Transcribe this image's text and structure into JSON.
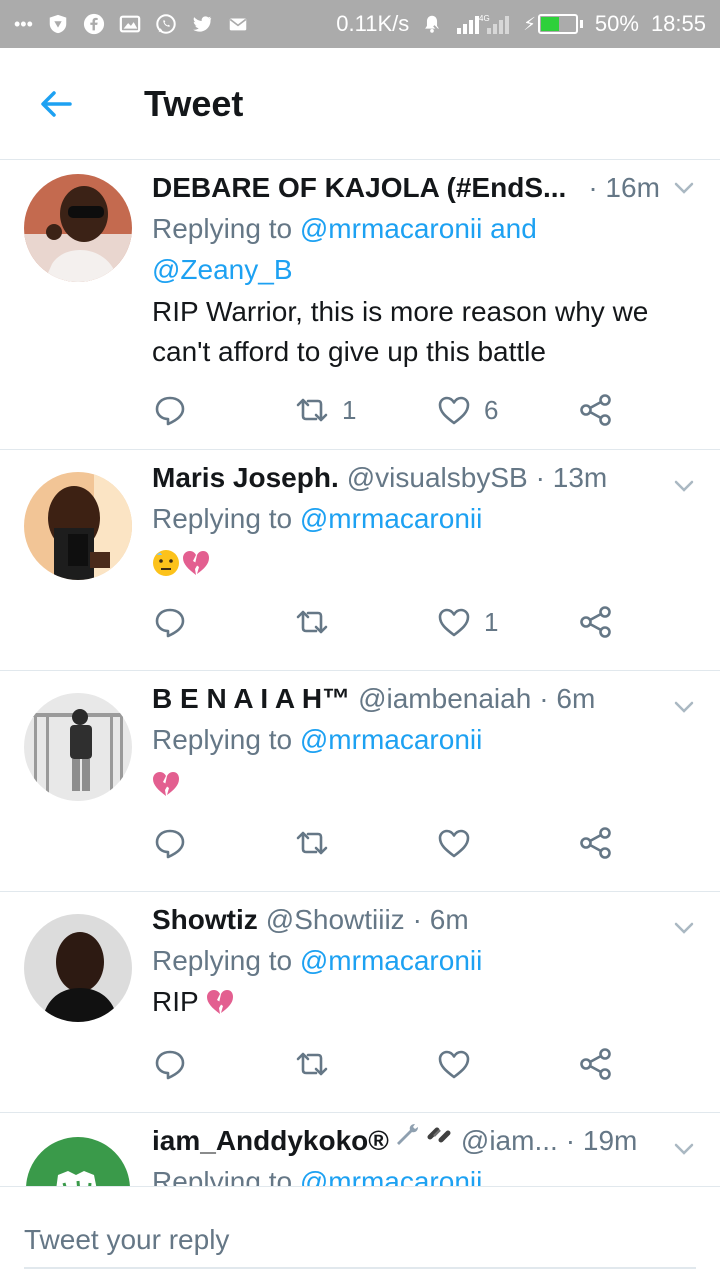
{
  "status_bar": {
    "dots": "•••",
    "speed": "0.11K/s",
    "network": "4G",
    "battery_percent": "50%",
    "battery_level": 0.5,
    "time": "18:55",
    "battery_color": "#2ed03b"
  },
  "header": {
    "title": "Tweet"
  },
  "tweets": [
    {
      "name": "DEBARE OF KAJOLA (#EndS...",
      "handle": "",
      "time": "· 16m",
      "replying_prefix": "Replying to ",
      "mentions": "@mrmacaronii and @Zeany_B",
      "text": "RIP Warrior, this is more reason why we can't afford to give up this battle",
      "retweets": "1",
      "likes": "6"
    },
    {
      "name": "Maris Joseph.",
      "handle": "@visualsbySB",
      "time": "· 13m",
      "replying_prefix": "Replying to ",
      "mentions": "@mrmacaronii",
      "text": "",
      "retweets": "",
      "likes": "1"
    },
    {
      "name": "B E N A I A H™",
      "handle": "@iambenaiah",
      "time": "· 6m",
      "replying_prefix": "Replying to ",
      "mentions": "@mrmacaronii",
      "text": "",
      "retweets": "",
      "likes": ""
    },
    {
      "name": "Showtiz",
      "handle": "@Showtiiiz",
      "time": "· 6m",
      "replying_prefix": "Replying to ",
      "mentions": "@mrmacaronii",
      "text": "RIP",
      "retweets": "",
      "likes": ""
    },
    {
      "name": "iam_Anddykoko®",
      "handle": "@iam...",
      "time": "· 19m",
      "replying_prefix": "Replying to ",
      "mentions": "@mrmacaronii",
      "text": "",
      "retweets": "",
      "likes": ""
    }
  ],
  "composer": {
    "placeholder": "Tweet your reply"
  },
  "colors": {
    "accent": "#1da1f2",
    "secondary_text": "#657786",
    "divider": "#e1e8ed"
  }
}
